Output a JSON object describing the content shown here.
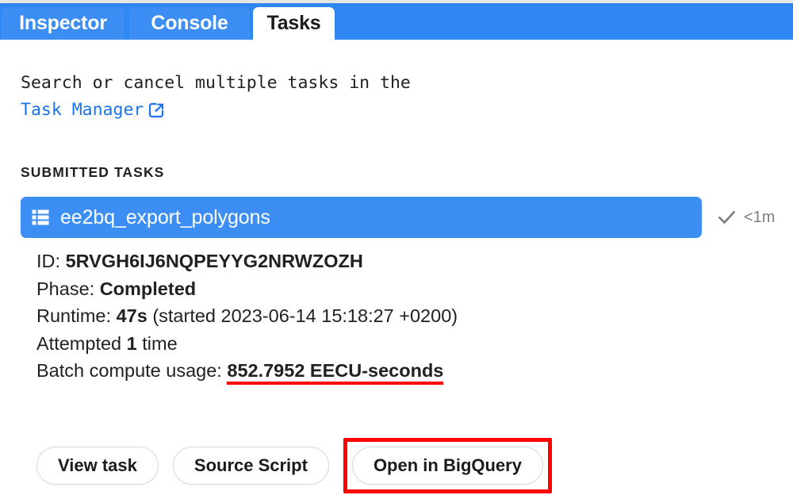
{
  "tabs": [
    {
      "label": "Inspector",
      "active": false
    },
    {
      "label": "Console",
      "active": false
    },
    {
      "label": "Tasks",
      "active": true
    }
  ],
  "intro": {
    "line1": "Search or cancel multiple tasks in the",
    "link_label": "Task Manager",
    "link_icon": "external-link-icon"
  },
  "section": {
    "title": "SUBMITTED TASKS"
  },
  "task": {
    "icon": "table-icon",
    "name": "ee2bq_export_polygons",
    "status_icon": "check-icon",
    "elapsed": "<1m",
    "row_color": "#3c8ef4",
    "details": {
      "id_label": "ID:",
      "id_value": "5RVGH6IJ6NQPEYYG2NRWZOZH",
      "phase_label": "Phase:",
      "phase_value": "Completed",
      "runtime_label": "Runtime:",
      "runtime_value": "47s",
      "runtime_started": "(started 2023-06-14 15:18:27 +0200)",
      "attempted_prefix": "Attempted",
      "attempted_value": "1",
      "attempted_suffix": "time",
      "batch_label": "Batch compute usage:",
      "batch_value": "852.7952 EECU-seconds"
    },
    "buttons": [
      {
        "label": "View task",
        "highlighted": false
      },
      {
        "label": "Source Script",
        "highlighted": false
      },
      {
        "label": "Open in BigQuery",
        "highlighted": true
      }
    ]
  },
  "highlight_color": "#ff0000"
}
